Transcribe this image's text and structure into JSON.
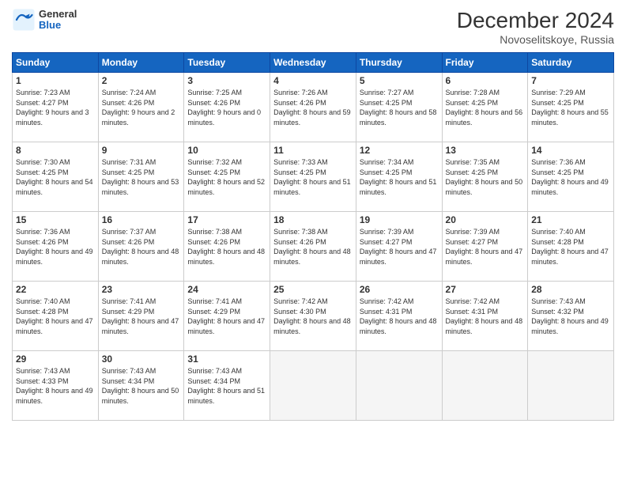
{
  "logo": {
    "general": "General",
    "blue": "Blue"
  },
  "title": "December 2024",
  "location": "Novoselitskoye, Russia",
  "days_header": [
    "Sunday",
    "Monday",
    "Tuesday",
    "Wednesday",
    "Thursday",
    "Friday",
    "Saturday"
  ],
  "weeks": [
    [
      {
        "day": "1",
        "sunrise": "7:23 AM",
        "sunset": "4:27 PM",
        "daylight": "9 hours and 3 minutes."
      },
      {
        "day": "2",
        "sunrise": "7:24 AM",
        "sunset": "4:26 PM",
        "daylight": "9 hours and 2 minutes."
      },
      {
        "day": "3",
        "sunrise": "7:25 AM",
        "sunset": "4:26 PM",
        "daylight": "9 hours and 0 minutes."
      },
      {
        "day": "4",
        "sunrise": "7:26 AM",
        "sunset": "4:26 PM",
        "daylight": "8 hours and 59 minutes."
      },
      {
        "day": "5",
        "sunrise": "7:27 AM",
        "sunset": "4:25 PM",
        "daylight": "8 hours and 58 minutes."
      },
      {
        "day": "6",
        "sunrise": "7:28 AM",
        "sunset": "4:25 PM",
        "daylight": "8 hours and 56 minutes."
      },
      {
        "day": "7",
        "sunrise": "7:29 AM",
        "sunset": "4:25 PM",
        "daylight": "8 hours and 55 minutes."
      }
    ],
    [
      {
        "day": "8",
        "sunrise": "7:30 AM",
        "sunset": "4:25 PM",
        "daylight": "8 hours and 54 minutes."
      },
      {
        "day": "9",
        "sunrise": "7:31 AM",
        "sunset": "4:25 PM",
        "daylight": "8 hours and 53 minutes."
      },
      {
        "day": "10",
        "sunrise": "7:32 AM",
        "sunset": "4:25 PM",
        "daylight": "8 hours and 52 minutes."
      },
      {
        "day": "11",
        "sunrise": "7:33 AM",
        "sunset": "4:25 PM",
        "daylight": "8 hours and 51 minutes."
      },
      {
        "day": "12",
        "sunrise": "7:34 AM",
        "sunset": "4:25 PM",
        "daylight": "8 hours and 51 minutes."
      },
      {
        "day": "13",
        "sunrise": "7:35 AM",
        "sunset": "4:25 PM",
        "daylight": "8 hours and 50 minutes."
      },
      {
        "day": "14",
        "sunrise": "7:36 AM",
        "sunset": "4:25 PM",
        "daylight": "8 hours and 49 minutes."
      }
    ],
    [
      {
        "day": "15",
        "sunrise": "7:36 AM",
        "sunset": "4:26 PM",
        "daylight": "8 hours and 49 minutes."
      },
      {
        "day": "16",
        "sunrise": "7:37 AM",
        "sunset": "4:26 PM",
        "daylight": "8 hours and 48 minutes."
      },
      {
        "day": "17",
        "sunrise": "7:38 AM",
        "sunset": "4:26 PM",
        "daylight": "8 hours and 48 minutes."
      },
      {
        "day": "18",
        "sunrise": "7:38 AM",
        "sunset": "4:26 PM",
        "daylight": "8 hours and 48 minutes."
      },
      {
        "day": "19",
        "sunrise": "7:39 AM",
        "sunset": "4:27 PM",
        "daylight": "8 hours and 47 minutes."
      },
      {
        "day": "20",
        "sunrise": "7:39 AM",
        "sunset": "4:27 PM",
        "daylight": "8 hours and 47 minutes."
      },
      {
        "day": "21",
        "sunrise": "7:40 AM",
        "sunset": "4:28 PM",
        "daylight": "8 hours and 47 minutes."
      }
    ],
    [
      {
        "day": "22",
        "sunrise": "7:40 AM",
        "sunset": "4:28 PM",
        "daylight": "8 hours and 47 minutes."
      },
      {
        "day": "23",
        "sunrise": "7:41 AM",
        "sunset": "4:29 PM",
        "daylight": "8 hours and 47 minutes."
      },
      {
        "day": "24",
        "sunrise": "7:41 AM",
        "sunset": "4:29 PM",
        "daylight": "8 hours and 47 minutes."
      },
      {
        "day": "25",
        "sunrise": "7:42 AM",
        "sunset": "4:30 PM",
        "daylight": "8 hours and 48 minutes."
      },
      {
        "day": "26",
        "sunrise": "7:42 AM",
        "sunset": "4:31 PM",
        "daylight": "8 hours and 48 minutes."
      },
      {
        "day": "27",
        "sunrise": "7:42 AM",
        "sunset": "4:31 PM",
        "daylight": "8 hours and 48 minutes."
      },
      {
        "day": "28",
        "sunrise": "7:43 AM",
        "sunset": "4:32 PM",
        "daylight": "8 hours and 49 minutes."
      }
    ],
    [
      {
        "day": "29",
        "sunrise": "7:43 AM",
        "sunset": "4:33 PM",
        "daylight": "8 hours and 49 minutes."
      },
      {
        "day": "30",
        "sunrise": "7:43 AM",
        "sunset": "4:34 PM",
        "daylight": "8 hours and 50 minutes."
      },
      {
        "day": "31",
        "sunrise": "7:43 AM",
        "sunset": "4:34 PM",
        "daylight": "8 hours and 51 minutes."
      },
      null,
      null,
      null,
      null
    ]
  ]
}
